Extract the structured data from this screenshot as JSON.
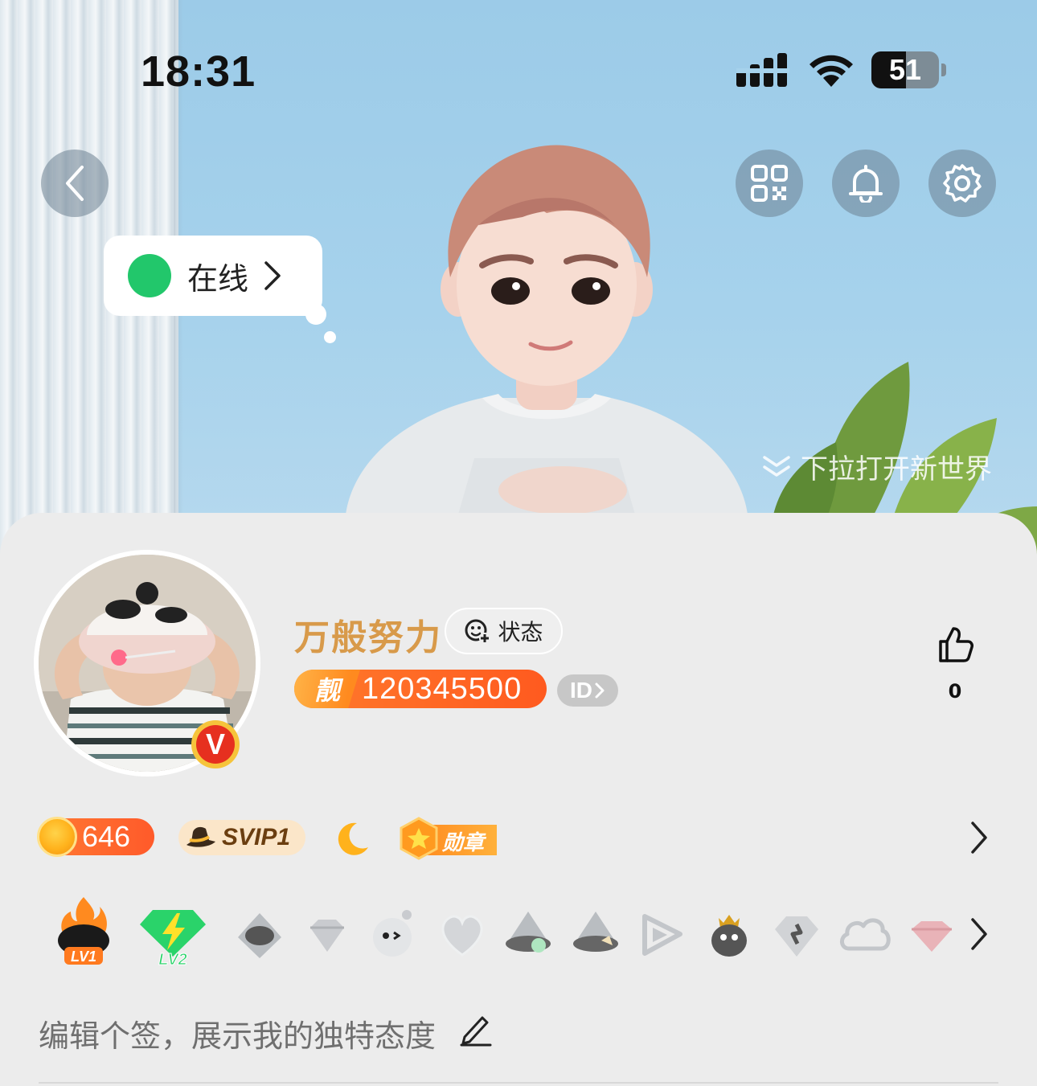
{
  "status_bar": {
    "time": "18:31",
    "battery": "51",
    "battery_fraction": 0.51
  },
  "header": {
    "online_status": "在线",
    "pull_hint": "下拉打开新世界"
  },
  "profile": {
    "nickname": "万般努力",
    "status_chip_label": "状态",
    "id_tag": "靓",
    "id_number": "120345500",
    "id_button_label": "ID",
    "vip_letter": "V",
    "like_count": "0"
  },
  "badges": {
    "coin_value": "646",
    "svip_label": "SVIP1",
    "medal_label": "勋章"
  },
  "level_icons": {
    "lv1_label": "LV1",
    "lv2_label": "LV2"
  },
  "signature": {
    "placeholder": "编辑个签，展示我的独特态度"
  },
  "colors": {
    "accent_orange": "#ff6a26",
    "nickname_gold": "#d89a4a",
    "online_green": "#22c76b"
  }
}
